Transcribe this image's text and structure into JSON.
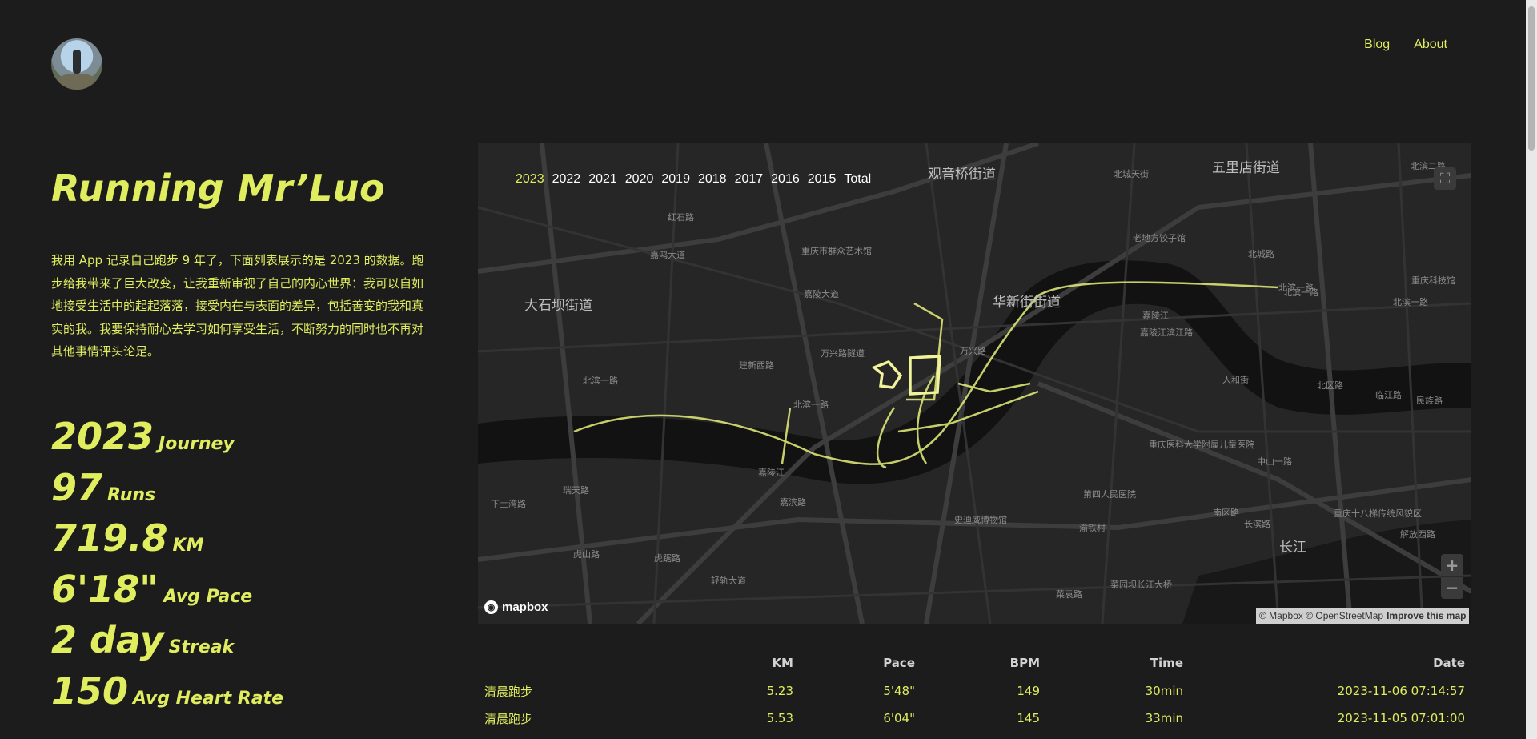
{
  "nav": {
    "blog": "Blog",
    "about": "About"
  },
  "title": "Running Mr’Luo",
  "intro": "我用 App 记录自己跑步 9 年了，下面列表展示的是 2023 的数据。跑步给我带来了巨大改变，让我重新审视了自己的内心世界：我可以自如地接受生活中的起起落落，接受内在与表面的差异，包括善变的我和真实的我。我要保持耐心去学习如何享受生活，不断努力的同时也不再对其他事情评头论足。",
  "stats": [
    {
      "value": "2023",
      "label": "Journey"
    },
    {
      "value": "97",
      "label": "Runs"
    },
    {
      "value": "719.8",
      "label": "KM"
    },
    {
      "value": "6'18\"",
      "label": "Avg Pace"
    },
    {
      "value": "2 day",
      "label": "Streak"
    },
    {
      "value": "150",
      "label": "Avg Heart Rate"
    }
  ],
  "years": [
    "2023",
    "2022",
    "2021",
    "2020",
    "2019",
    "2018",
    "2017",
    "2016",
    "2015",
    "Total"
  ],
  "selected_year": "2023",
  "map": {
    "places_big": [
      "观音桥街道",
      "五里店街道",
      "大石坝街道",
      "华新街街道",
      "长江"
    ],
    "places_small": [
      "北滨二路",
      "北城天街",
      "红石路",
      "嘉鸿大道",
      "重庆市群众艺术馆",
      "北城路",
      "老地方饺子馆",
      "重庆科技馆",
      "嘉陵大道",
      "北滨一路",
      "北滨一路",
      "北滨一路",
      "嘉陵江",
      "嘉陵江滨江路",
      "建新西路",
      "万兴路隧道",
      "万兴路",
      "北滨一路",
      "北滨一路",
      "嘉陵江",
      "北区路",
      "人和街",
      "临江路",
      "民族路",
      "重庆医科大学附属儿童医院",
      "中山一路",
      "嘉滨路",
      "第四人民医院",
      "下土湾路",
      "瑞天路",
      "南区路",
      "长滨路",
      "重庆十八梯传统风貌区",
      "解放西路",
      "虎山路",
      "虎踞路",
      "轻轨大道",
      "史迪威博物馆",
      "菜园坝长江大桥",
      "菜袁路",
      "渝铁村",
      "长江"
    ],
    "fullscreen_icon": "expand-icon",
    "zoom_in": "+",
    "zoom_out": "−",
    "logo": "mapbox",
    "attribution": "© Mapbox © OpenStreetMap",
    "improve": "Improve this map"
  },
  "table": {
    "headers": [
      "",
      "KM",
      "Pace",
      "BPM",
      "Time",
      "Date"
    ],
    "rows": [
      {
        "name": "清晨跑步",
        "km": "5.23",
        "pace": "5'48\"",
        "bpm": "149",
        "time": "30min",
        "date": "2023-11-06 07:14:57"
      },
      {
        "name": "清晨跑步",
        "km": "5.53",
        "pace": "6'04\"",
        "bpm": "145",
        "time": "33min",
        "date": "2023-11-05 07:01:00"
      }
    ]
  }
}
